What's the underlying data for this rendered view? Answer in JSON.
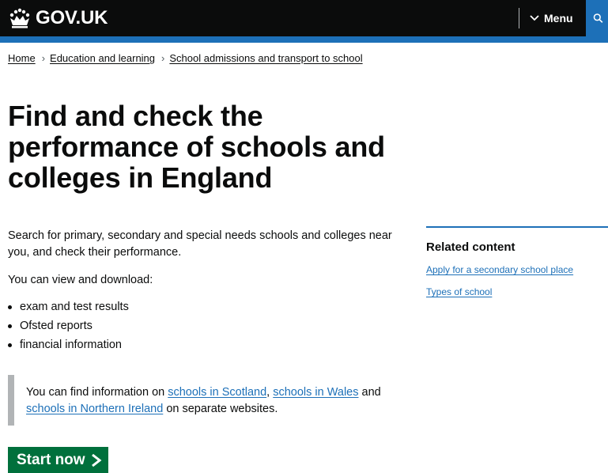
{
  "header": {
    "logo_text": "GOV.UK",
    "menu_label": "Menu",
    "colors": {
      "header_bg": "#0b0c0c",
      "accent": "#1d70b8"
    }
  },
  "breadcrumbs": [
    {
      "label": "Home"
    },
    {
      "label": "Education and learning"
    },
    {
      "label": "School admissions and transport to school"
    }
  ],
  "page": {
    "title": "Find and check the performance of schools and colleges in England",
    "lead": "Search for primary, secondary and special needs schools and colleges near you, and check their performance.",
    "view_download": "You can view and download:",
    "bullets": [
      "exam and test results",
      "Ofsted reports",
      "financial information"
    ],
    "inset": {
      "prefix": "You can find information on ",
      "link_scotland": "schools in Scotland",
      "comma": ", ",
      "link_wales": "schools in Wales",
      "and": " and ",
      "link_ni": "schools in Northern Ireland",
      "suffix": " on separate websites."
    },
    "start_button": "Start now",
    "start_color": "#00703c"
  },
  "related": {
    "heading": "Related content",
    "links": [
      "Apply for a secondary school place",
      "Types of school"
    ]
  }
}
